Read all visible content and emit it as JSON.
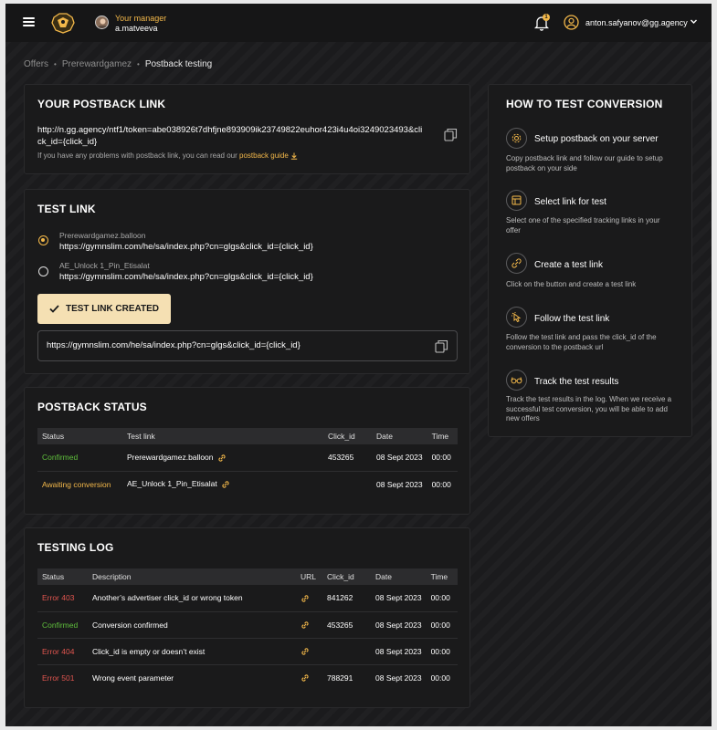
{
  "header": {
    "manager_label": "Your manager",
    "manager_name": "a.matveeva",
    "notification_count": "1",
    "user_email": "anton.safyanov@gg.agency"
  },
  "breadcrumb": [
    "Offers",
    "Prerewardgamez",
    "Postback testing"
  ],
  "postback": {
    "title": "YOUR POSTBACK LINK",
    "url": "http://n.gg.agency/ntf1/token=abe038926t7dhfjne893909ik23749822euhor423i4u4oi3249023493&click_id={click_id}",
    "hint": "If you have any problems with postback link, you can read our",
    "guide_link": "postback guide"
  },
  "test_link": {
    "title": "TEST LINK",
    "options": [
      {
        "name": "Prerewardgamez.balloon",
        "url": "https://gymnslim.com/he/sa/index.php?cn=glgs&click_id={click_id}",
        "selected": true
      },
      {
        "name": "AE_Unlock 1_Pin_Etisalat",
        "url": "https://gymnslim.com/he/sa/index.php?cn=glgs&click_id={click_id}",
        "selected": false
      }
    ],
    "button_label": "TEST LINK CREATED",
    "generated_url": "https://gymnslim.com/he/sa/index.php?cn=glgs&click_id={click_id}"
  },
  "postback_status": {
    "title": "POSTBACK STATUS",
    "columns": [
      "Status",
      "Test link",
      "Click_id",
      "Date",
      "Time"
    ],
    "rows": [
      {
        "status": "Confirmed",
        "status_color": "#5fbf3c",
        "link": "Prerewardgamez.balloon",
        "click_id": "453265",
        "date": "08 Sept 2023",
        "time": "00:00"
      },
      {
        "status": "Awaiting conversion",
        "status_color": "#f3b84a",
        "link": "AE_Unlock 1_Pin_Etisalat",
        "click_id": "",
        "date": "08 Sept 2023",
        "time": "00:00"
      }
    ]
  },
  "testing_log": {
    "title": "TESTING LOG",
    "columns": [
      "Status",
      "Description",
      "URL",
      "Click_id",
      "Date",
      "Time"
    ],
    "rows": [
      {
        "status": "Error 403",
        "status_color": "#e0554f",
        "description": "Another’s advertiser click_id or wrong token",
        "click_id": "841262",
        "date": "08 Sept 2023",
        "time": "00:00"
      },
      {
        "status": "Confirmed",
        "status_color": "#5fbf3c",
        "description": "Conversion confirmed",
        "click_id": "453265",
        "date": "08 Sept 2023",
        "time": "00:00"
      },
      {
        "status": "Error 404",
        "status_color": "#e0554f",
        "description": "Click_id is empty or doesn’t exist",
        "click_id": "",
        "date": "08 Sept 2023",
        "time": "00:00"
      },
      {
        "status": "Error 501",
        "status_color": "#e0554f",
        "description": "Wrong event parameter",
        "click_id": "788291",
        "date": "08 Sept 2023",
        "time": "00:00"
      }
    ]
  },
  "how_to": {
    "title": "HOW TO TEST CONVERSION",
    "steps": [
      {
        "icon": "gear-icon",
        "title": "Setup postback on your server",
        "desc": "Copy postback link and follow our guide to setup postback on your side"
      },
      {
        "icon": "window-icon",
        "title": "Select link for test",
        "desc": "Select one of the specified tracking links in your offer"
      },
      {
        "icon": "link-icon",
        "title": "Create a test link",
        "desc": "Click on the button and create a test link"
      },
      {
        "icon": "pointer-icon",
        "title": "Follow the test link",
        "desc": "Follow the test link and pass the click_id of the conversion to the postback url"
      },
      {
        "icon": "glasses-icon",
        "title": "Track the test results",
        "desc": "Track the test results in the log. When we receive a successful test conversion, you will be able to add new offers"
      }
    ]
  },
  "colors": {
    "accent": "#f3b84a",
    "success": "#5fbf3c",
    "error": "#e0554f",
    "background": "#1c1c1e"
  }
}
